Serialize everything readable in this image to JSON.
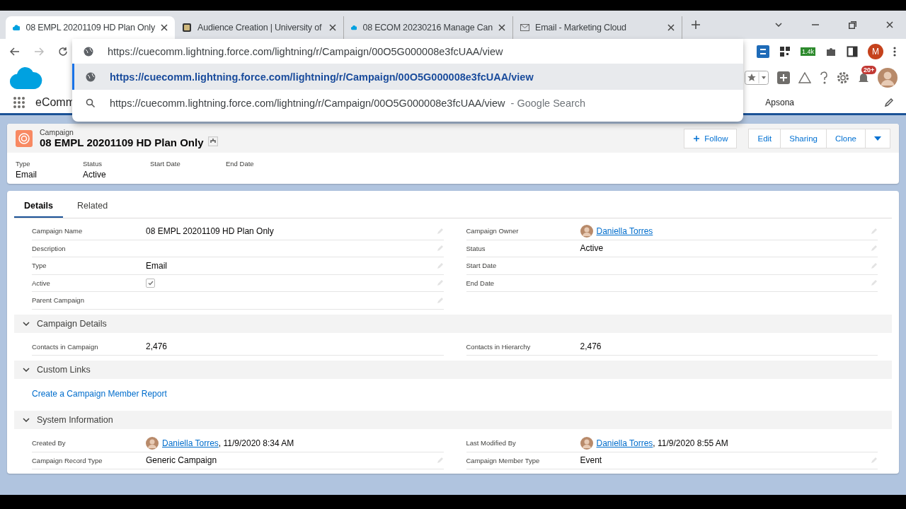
{
  "browser": {
    "tabs": [
      {
        "title": "08 EMPL 20201109 HD Plan Only",
        "kind": "record",
        "selected": true
      },
      {
        "title": "Audience Creation | University of",
        "kind": "website",
        "selected": false
      },
      {
        "title": "08 ECOM 20230216 Manage Can",
        "kind": "record",
        "selected": false
      },
      {
        "title": "Email - Marketing Cloud",
        "kind": "email",
        "selected": false
      }
    ],
    "address": "https://cuecomm.lightning.force.com/lightning/r/Campaign/00O5G000008e3fcUAA/view",
    "extension_badge": "1.4k",
    "profile_initial": "M",
    "suggestions": [
      {
        "kind": "page",
        "url": "https://cuecomm.lightning.force.com/lightning/r/Campaign/00O5G000008e3fcUAA/view",
        "selected": true
      },
      {
        "kind": "search",
        "url": "https://cuecomm.lightning.force.com/lightning/r/Campaign/00O5G000008e3fcUAA/view",
        "suffix": "- Google Search",
        "selected": false
      }
    ]
  },
  "app": {
    "name": "eComm",
    "nav_item": "Apsona",
    "notification_count": "20+"
  },
  "record": {
    "object": "Campaign",
    "title": "08 EMPL 20201109 HD Plan Only",
    "buttons": [
      "Edit",
      "Sharing",
      "Clone"
    ],
    "follow": "Follow",
    "highlights": [
      {
        "label": "Type",
        "value": "Email"
      },
      {
        "label": "Status",
        "value": "Active"
      },
      {
        "label": "Start Date"
      },
      {
        "label": "End Date"
      }
    ]
  },
  "tabs": [
    {
      "label": "Details",
      "selected": true
    },
    {
      "label": "Related",
      "selected": false
    }
  ],
  "sections": [
    {
      "rows": [
        [
          {
            "label": "Campaign Name",
            "kind": "text",
            "value": "08 EMPL 20201109 HD Plan Only",
            "editable": true
          },
          {
            "label": "Campaign Owner",
            "kind": "user",
            "value": "Daniella Torres",
            "editable": true
          }
        ],
        [
          {
            "label": "Description",
            "kind": "text",
            "editable": true
          },
          {
            "label": "Status",
            "kind": "text",
            "value": "Active",
            "editable": true
          }
        ],
        [
          {
            "label": "Type",
            "kind": "text",
            "value": "Email",
            "editable": true
          },
          {
            "label": "Start Date",
            "kind": "text",
            "editable": true
          }
        ],
        [
          {
            "label": "Active",
            "kind": "checkbox",
            "checked": true,
            "editable": true
          },
          {
            "label": "End Date",
            "kind": "text",
            "editable": true
          }
        ],
        [
          {
            "label": "Parent Campaign",
            "kind": "text",
            "editable": true
          }
        ]
      ]
    },
    {
      "title": "Campaign Details",
      "expanded": true,
      "rows": [
        [
          {
            "label": "Contacts in Campaign",
            "kind": "text",
            "value": "2,476",
            "editable": false
          },
          {
            "label": "Contacts in Hierarchy",
            "kind": "text",
            "value": "2,476",
            "editable": false
          }
        ]
      ]
    },
    {
      "title": "Custom Links",
      "expanded": true,
      "links": [
        "Create a Campaign Member Report"
      ]
    },
    {
      "title": "System Information",
      "expanded": true,
      "rows": [
        [
          {
            "label": "Created By",
            "kind": "user",
            "value": "Daniella Torres",
            "suffix": ", 11/9/2020 8:34 AM",
            "editable": false
          },
          {
            "label": "Last Modified By",
            "kind": "user",
            "value": "Daniella Torres",
            "suffix": ", 11/9/2020 8:55 AM",
            "editable": false
          }
        ],
        [
          {
            "label": "Campaign Record Type",
            "kind": "text",
            "value": "Generic Campaign",
            "editable": true
          },
          {
            "label": "Campaign Member Type",
            "kind": "text",
            "value": "Event",
            "editable": true
          }
        ]
      ]
    }
  ]
}
